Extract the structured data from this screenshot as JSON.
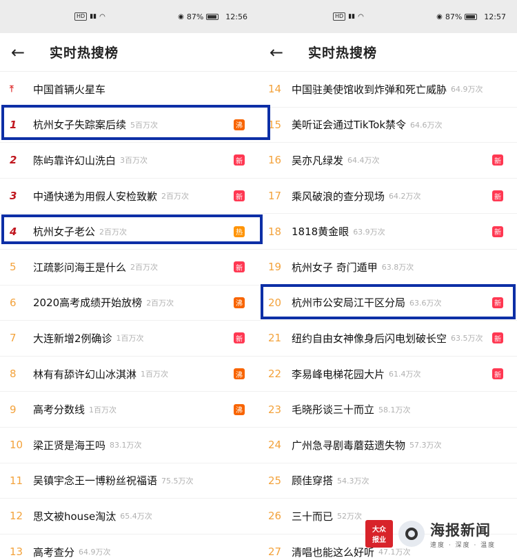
{
  "left": {
    "status": {
      "battery": "87%",
      "time": "12:56"
    },
    "title": "实时热搜榜",
    "items": [
      {
        "rank": "",
        "rank_style": "pin",
        "title": "中国首辆火星车",
        "heat": "",
        "tag": ""
      },
      {
        "rank": "1",
        "rank_style": "red",
        "title": "杭州女子失踪案后续",
        "heat": "5百万次",
        "tag": "沸",
        "tag_type": "boil"
      },
      {
        "rank": "2",
        "rank_style": "red",
        "title": "陈屿靠许幻山洗白",
        "heat": "3百万次",
        "tag": "新",
        "tag_type": "new"
      },
      {
        "rank": "3",
        "rank_style": "red",
        "title": "中通快递为用假人安检致歉",
        "heat": "2百万次",
        "tag": "新",
        "tag_type": "new"
      },
      {
        "rank": "4",
        "rank_style": "red",
        "title": "杭州女子老公",
        "heat": "2百万次",
        "tag": "热",
        "tag_type": "hot"
      },
      {
        "rank": "5",
        "rank_style": "orange",
        "title": "江疏影问海王是什么",
        "heat": "2百万次",
        "tag": "新",
        "tag_type": "new"
      },
      {
        "rank": "6",
        "rank_style": "orange",
        "title": "2020高考成绩开始放榜",
        "heat": "2百万次",
        "tag": "沸",
        "tag_type": "boil"
      },
      {
        "rank": "7",
        "rank_style": "orange",
        "title": "大连新增2例确诊",
        "heat": "1百万次",
        "tag": "新",
        "tag_type": "new"
      },
      {
        "rank": "8",
        "rank_style": "orange",
        "title": "林有有舔许幻山冰淇淋",
        "heat": "1百万次",
        "tag": "沸",
        "tag_type": "boil"
      },
      {
        "rank": "9",
        "rank_style": "orange",
        "title": "高考分数线",
        "heat": "1百万次",
        "tag": "沸",
        "tag_type": "boil"
      },
      {
        "rank": "10",
        "rank_style": "orange",
        "title": "梁正贤是海王吗",
        "heat": "83.1万次",
        "tag": ""
      },
      {
        "rank": "11",
        "rank_style": "orange",
        "title": "吴镇宇念王一博粉丝祝福语",
        "heat": "75.5万次",
        "tag": ""
      },
      {
        "rank": "12",
        "rank_style": "orange",
        "title": "思文被house淘汰",
        "heat": "65.4万次",
        "tag": ""
      },
      {
        "rank": "13",
        "rank_style": "orange",
        "title": "高考查分",
        "heat": "64.9万次",
        "tag": ""
      }
    ]
  },
  "right": {
    "status": {
      "battery": "87%",
      "time": "12:57"
    },
    "title": "实时热搜榜",
    "items": [
      {
        "rank": "14",
        "rank_style": "orange",
        "title": "中国驻美使馆收到炸弹和死亡威胁",
        "heat": "64.9万次",
        "tag": ""
      },
      {
        "rank": "15",
        "rank_style": "orange",
        "title": "美听证会通过TikTok禁令",
        "heat": "64.6万次",
        "tag": ""
      },
      {
        "rank": "16",
        "rank_style": "orange",
        "title": "吴亦凡绿发",
        "heat": "64.4万次",
        "tag": "新",
        "tag_type": "new"
      },
      {
        "rank": "17",
        "rank_style": "orange",
        "title": "乘风破浪的查分现场",
        "heat": "64.2万次",
        "tag": "新",
        "tag_type": "new"
      },
      {
        "rank": "18",
        "rank_style": "orange",
        "title": "1818黄金眼",
        "heat": "63.9万次",
        "tag": "新",
        "tag_type": "new"
      },
      {
        "rank": "19",
        "rank_style": "orange",
        "title": "杭州女子 奇门遁甲",
        "heat": "63.8万次",
        "tag": ""
      },
      {
        "rank": "20",
        "rank_style": "orange",
        "title": "杭州市公安局江干区分局",
        "heat": "63.6万次",
        "tag": "新",
        "tag_type": "new"
      },
      {
        "rank": "21",
        "rank_style": "orange",
        "title": "纽约自由女神像身后闪电划破长空",
        "heat": "63.5万次",
        "tag": "新",
        "tag_type": "new"
      },
      {
        "rank": "22",
        "rank_style": "orange",
        "title": "李易峰电梯花园大片",
        "heat": "61.4万次",
        "tag": "新",
        "tag_type": "new"
      },
      {
        "rank": "23",
        "rank_style": "orange",
        "title": "毛晓彤谈三十而立",
        "heat": "58.1万次",
        "tag": ""
      },
      {
        "rank": "24",
        "rank_style": "orange",
        "title": "广州急寻剧毒蘑菇遗失物",
        "heat": "57.3万次",
        "tag": ""
      },
      {
        "rank": "25",
        "rank_style": "orange",
        "title": "顾佳穿搭",
        "heat": "54.3万次",
        "tag": ""
      },
      {
        "rank": "26",
        "rank_style": "orange",
        "title": "三十而已",
        "heat": "52万次",
        "tag": ""
      },
      {
        "rank": "27",
        "rank_style": "orange",
        "title": "清唱也能这么好听",
        "heat": "47.1万次",
        "tag": ""
      }
    ]
  },
  "watermark": {
    "badge_line1": "大众",
    "badge_line2": "报业",
    "name": "海报新闻",
    "slogan": "速度 · 深度 · 温度"
  },
  "colors": {
    "highlight": "#0d2fa6",
    "rank_top": "#c0161e",
    "rank_other": "#f3a23b",
    "tag_new": "#ff3852",
    "tag_boil": "#f86400",
    "tag_hot": "#ff9406"
  }
}
